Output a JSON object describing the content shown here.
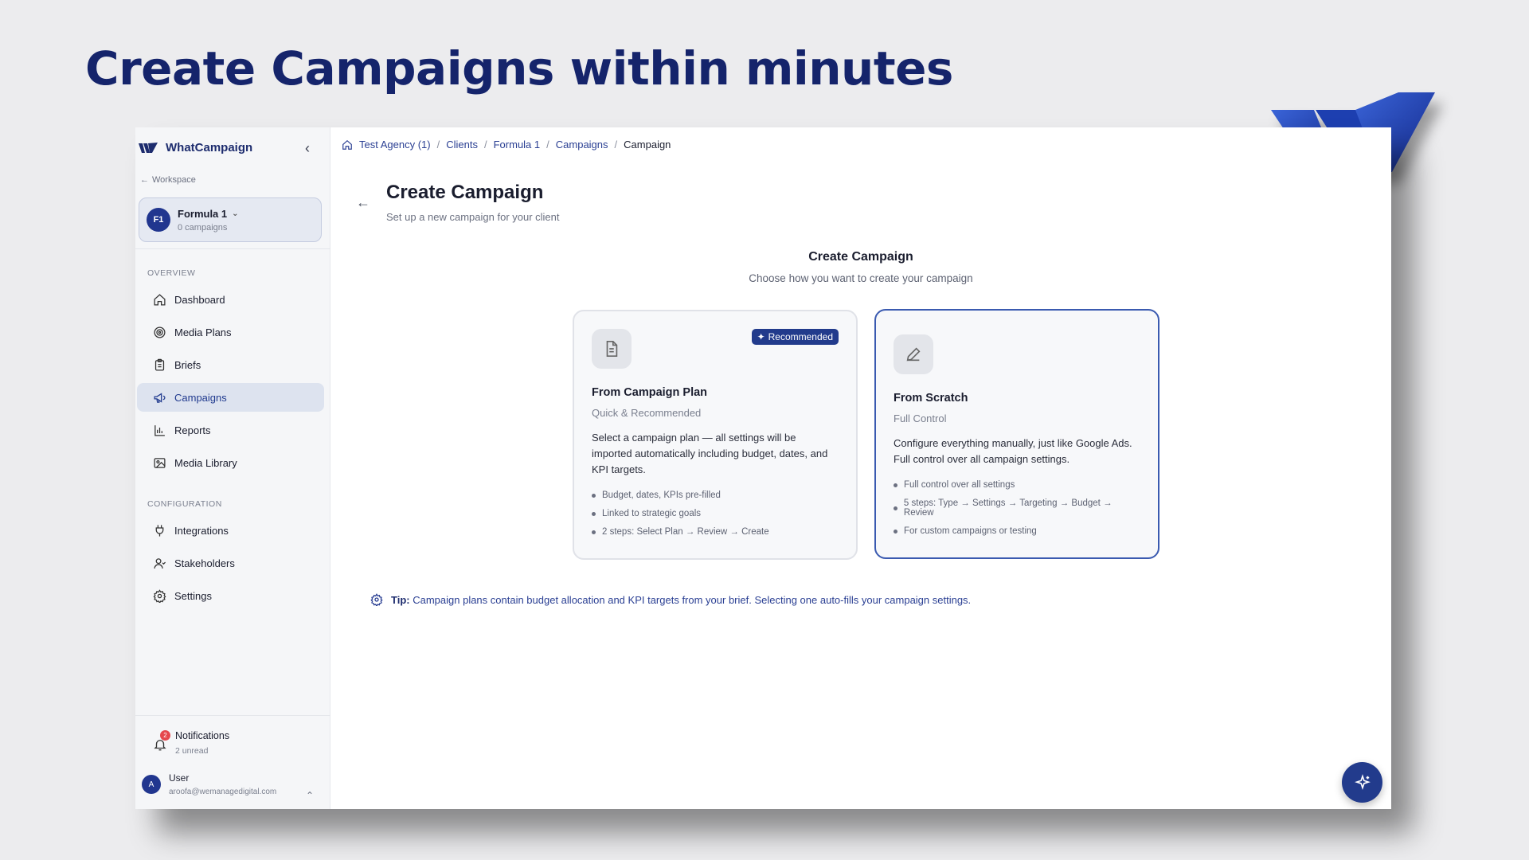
{
  "headline": "Create Campaigns within minutes",
  "sidebar": {
    "brand": "WhatCampaign",
    "back_label": "Workspace",
    "client": {
      "initials": "F1",
      "name": "Formula 1",
      "campaigns": "0 campaigns"
    },
    "overview_label": "OVERVIEW",
    "overview_items": [
      {
        "label": "Dashboard",
        "icon": "home-icon"
      },
      {
        "label": "Media Plans",
        "icon": "target-icon"
      },
      {
        "label": "Briefs",
        "icon": "clipboard-icon"
      },
      {
        "label": "Campaigns",
        "icon": "megaphone-icon",
        "active": true
      },
      {
        "label": "Reports",
        "icon": "bar-chart-icon"
      },
      {
        "label": "Media Library",
        "icon": "image-icon"
      }
    ],
    "configuration_label": "CONFIGURATION",
    "config_items": [
      {
        "label": "Integrations",
        "icon": "plug-icon"
      },
      {
        "label": "Stakeholders",
        "icon": "user-icon"
      },
      {
        "label": "Settings",
        "icon": "gear-icon"
      }
    ],
    "notifications": {
      "label": "Notifications",
      "count": "2",
      "sub": "2 unread"
    },
    "user": {
      "initial": "A",
      "name": "User",
      "email": "aroofa@wemanagedigital.com"
    }
  },
  "breadcrumb": [
    "Test Agency (1)",
    "Clients",
    "Formula 1",
    "Campaigns",
    "Campaign"
  ],
  "page": {
    "title": "Create Campaign",
    "subtitle": "Set up a new campaign for your client",
    "section_title": "Create Campaign",
    "section_subtitle": "Choose how you want to create your campaign"
  },
  "cards": {
    "plan": {
      "badge": "Recommended",
      "title": "From Campaign Plan",
      "subtitle": "Quick & Recommended",
      "description": "Select a campaign plan — all settings will be imported automatically including budget, dates, and KPI targets.",
      "bullets": [
        "Budget, dates, KPIs pre-filled",
        "Linked to strategic goals",
        "2 steps: Select Plan → Review → Create"
      ]
    },
    "scratch": {
      "title": "From Scratch",
      "subtitle": "Full Control",
      "description": "Configure everything manually, just like Google Ads. Full control over all campaign settings.",
      "bullets": [
        "Full control over all settings",
        "5 steps: Type → Settings → Targeting → Budget → Review",
        "For custom campaigns or testing"
      ]
    }
  },
  "tip": {
    "label": "Tip:",
    "text": "Campaign plans contain budget allocation and KPI targets from your brief. Selecting one auto-fills your campaign settings."
  },
  "colors": {
    "brand_navy": "#15246b",
    "accent": "#223b8c",
    "active_bg": "#dde3ef",
    "badge_red": "#e5484d"
  }
}
